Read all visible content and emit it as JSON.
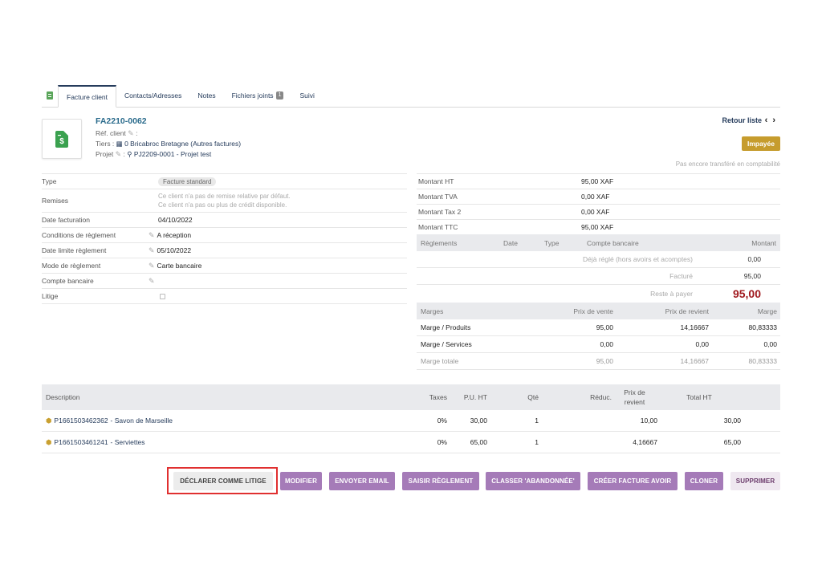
{
  "tabs": [
    {
      "label": "Facture client",
      "active": true
    },
    {
      "label": "Contacts/Adresses"
    },
    {
      "label": "Notes"
    },
    {
      "label": "Fichiers joints",
      "badge": "1"
    },
    {
      "label": "Suivi"
    }
  ],
  "header": {
    "ref": "FA2210-0062",
    "ref_client_label": "Réf. client",
    "ref_client_suffix": ":",
    "tiers_label": "Tiers :",
    "tiers_value": "0 Bricabroc Bretagne (Autres factures)",
    "projet_label": "Projet",
    "projet_sep": ":",
    "projet_value": "PJ2209-0001 - Projet test",
    "retour": "Retour liste",
    "status": "Impayée",
    "compta": "Pas encore transféré en comptabilité"
  },
  "left": {
    "type_label": "Type",
    "type_value": "Facture standard",
    "remises_label": "Remises",
    "remises_line1": "Ce client n'a pas de remise relative par défaut.",
    "remises_line2": "Ce client n'a pas ou plus de crédit disponible.",
    "date_fact_label": "Date facturation",
    "date_fact_value": "04/10/2022",
    "cond_label": "Conditions de règlement",
    "cond_value": "A réception",
    "date_lim_label": "Date limite règlement",
    "date_lim_value": "05/10/2022",
    "mode_label": "Mode de règlement",
    "mode_value": "Carte bancaire",
    "compte_label": "Compte bancaire",
    "litige_label": "Litige"
  },
  "amounts": {
    "ht_label": "Montant HT",
    "ht_value": "95,00 XAF",
    "tva_label": "Montant TVA",
    "tva_value": "0,00 XAF",
    "tax2_label": "Montant Tax 2",
    "tax2_value": "0,00 XAF",
    "ttc_label": "Montant TTC",
    "ttc_value": "95,00 XAF"
  },
  "reglements": {
    "h_regl": "Règlements",
    "h_date": "Date",
    "h_type": "Type",
    "h_compte": "Compte bancaire",
    "h_montant": "Montant",
    "deja_label": "Déjà réglé (hors avoirs et acomptes)",
    "deja_value": "0,00",
    "facture_label": "Facturé",
    "facture_value": "95,00",
    "reste_label": "Reste à payer",
    "reste_value": "95,00"
  },
  "marges": {
    "h_marges": "Marges",
    "h_pv": "Prix de vente",
    "h_pr": "Prix de revient",
    "h_marge": "Marge",
    "rows": [
      {
        "label": "Marge / Produits",
        "pv": "95,00",
        "pr": "14,16667",
        "marge": "80,83333"
      },
      {
        "label": "Marge / Services",
        "pv": "0,00",
        "pr": "0,00",
        "marge": "0,00"
      },
      {
        "label": "Marge totale",
        "pv": "95,00",
        "pr": "14,16667",
        "marge": "80,83333"
      }
    ]
  },
  "lines": {
    "h_desc": "Description",
    "h_taxes": "Taxes",
    "h_pu": "P.U. HT",
    "h_qte": "Qté",
    "h_red": "Réduc.",
    "h_pr1": "Prix de",
    "h_pr2": "revient",
    "h_total": "Total HT",
    "rows": [
      {
        "ref": "P1661503462362",
        "label": " - Savon de Marseille",
        "tax": "0%",
        "pu": "30,00",
        "qte": "1",
        "pr": "10,00",
        "total": "30,00"
      },
      {
        "ref": "P1661503461241",
        "label": " - Serviettes",
        "tax": "0%",
        "pu": "65,00",
        "qte": "1",
        "pr": "4,16667",
        "total": "65,00"
      }
    ]
  },
  "buttons": {
    "litige": "DÉCLARER COMME LITIGE",
    "modifier": "MODIFIER",
    "email": "ENVOYER EMAIL",
    "reglement": "SAISIR RÈGLEMENT",
    "abandon": "CLASSER 'ABANDONNÉE'",
    "avoir": "CRÉER FACTURE AVOIR",
    "cloner": "CLONER",
    "supprimer": "SUPPRIMER"
  },
  "colors": {
    "accent": "#a57bb8",
    "status": "#c69c2d",
    "highlight": "#e03030",
    "reste": "#a0191e"
  }
}
